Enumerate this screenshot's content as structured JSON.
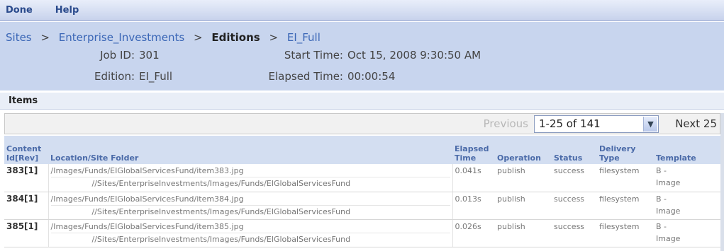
{
  "menu": {
    "done": "Done",
    "help": "Help"
  },
  "breadcrumb": {
    "sites": "Sites",
    "site": "Enterprise_Investments",
    "editions": "Editions",
    "edition": "EI_Full",
    "separator": ">"
  },
  "job": {
    "job_id_label": "Job ID:",
    "job_id": "301",
    "edition_label": "Edition:",
    "edition": "EI_Full",
    "start_label": "Start Time:",
    "start_time": "Oct 15, 2008 9:30:50 AM",
    "elapsed_label": "Elapsed Time:",
    "elapsed_time": "00:00:54"
  },
  "items_title": "Items",
  "pager": {
    "previous": "Previous",
    "range": "1-25 of 141",
    "next": "Next 25"
  },
  "columns": {
    "content_id_1": "Content",
    "content_id_2": "Id[Rev]",
    "location": "Location/Site Folder",
    "elapsed_1": "Elapsed",
    "elapsed_2": "Time",
    "operation": "Operation",
    "status": "Status",
    "delivery_1": "Delivery",
    "delivery_2": "Type",
    "template": "Template"
  },
  "rows": [
    {
      "content_id": "383[1]",
      "location": "/Images/Funds/EIGlobalServicesFund/item383.jpg",
      "site_folder": "//Sites/EnterpriseInvestments/Images/Funds/EIGlobalServicesFund",
      "elapsed": "0.041s",
      "operation": "publish",
      "status": "success",
      "delivery": "filesystem",
      "template_1": "B -",
      "template_2": "Image"
    },
    {
      "content_id": "384[1]",
      "location": "/Images/Funds/EIGlobalServicesFund/item384.jpg",
      "site_folder": "//Sites/EnterpriseInvestments/Images/Funds/EIGlobalServicesFund",
      "elapsed": "0.013s",
      "operation": "publish",
      "status": "success",
      "delivery": "filesystem",
      "template_1": "B -",
      "template_2": "Image"
    },
    {
      "content_id": "385[1]",
      "location": "/Images/Funds/EIGlobalServicesFund/item385.jpg",
      "site_folder": "//Sites/EnterpriseInvestments/Images/Funds/EIGlobalServicesFund",
      "elapsed": "0.026s",
      "operation": "publish",
      "status": "success",
      "delivery": "filesystem",
      "template_1": "B -",
      "template_2": "Image"
    }
  ]
}
